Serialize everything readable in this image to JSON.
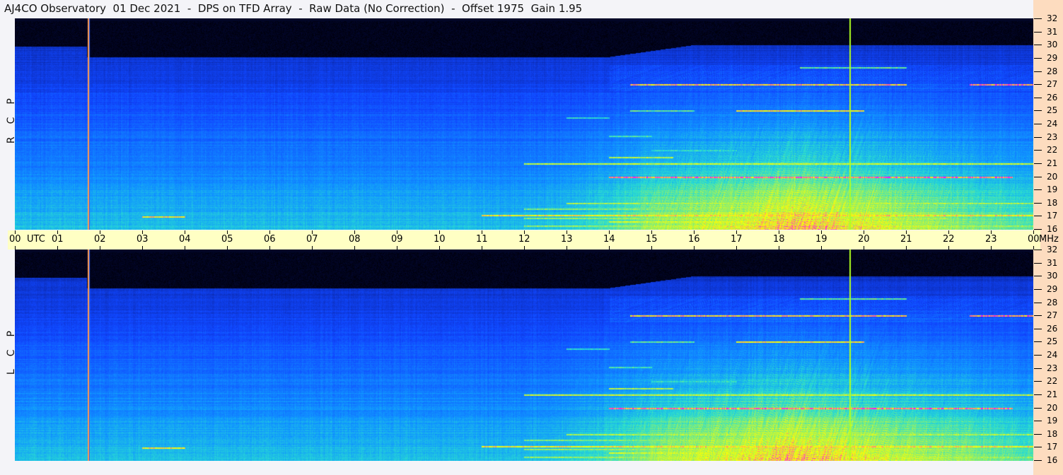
{
  "title": "AJ4CO Observatory  01 Dec 2021  -  DPS on TFD Array  -  Raw Data (No Correction)  -  Offset 1975  Gain 1.95",
  "panels": [
    {
      "polarization": [
        "R",
        "C",
        "P"
      ]
    },
    {
      "polarization": [
        "L",
        "C",
        "P"
      ]
    }
  ],
  "time_axis": {
    "labels": [
      "00",
      "01",
      "02",
      "03",
      "04",
      "05",
      "06",
      "07",
      "08",
      "09",
      "10",
      "11",
      "12",
      "13",
      "14",
      "15",
      "16",
      "17",
      "18",
      "19",
      "20",
      "21",
      "22",
      "23",
      "00"
    ],
    "utc_label": "UTC",
    "unit_label": "MHz"
  },
  "freq_axis": {
    "labels": [
      "32",
      "31",
      "30",
      "29",
      "28",
      "27",
      "26",
      "25",
      "24",
      "23",
      "22",
      "21",
      "20",
      "19",
      "18",
      "17",
      "16"
    ]
  },
  "colors": {
    "marker_orange": "#ff9a50",
    "marker_green": "#b0ff20",
    "axis_bg": "#ffffc4",
    "side_bg": "#fddcbf"
  }
}
